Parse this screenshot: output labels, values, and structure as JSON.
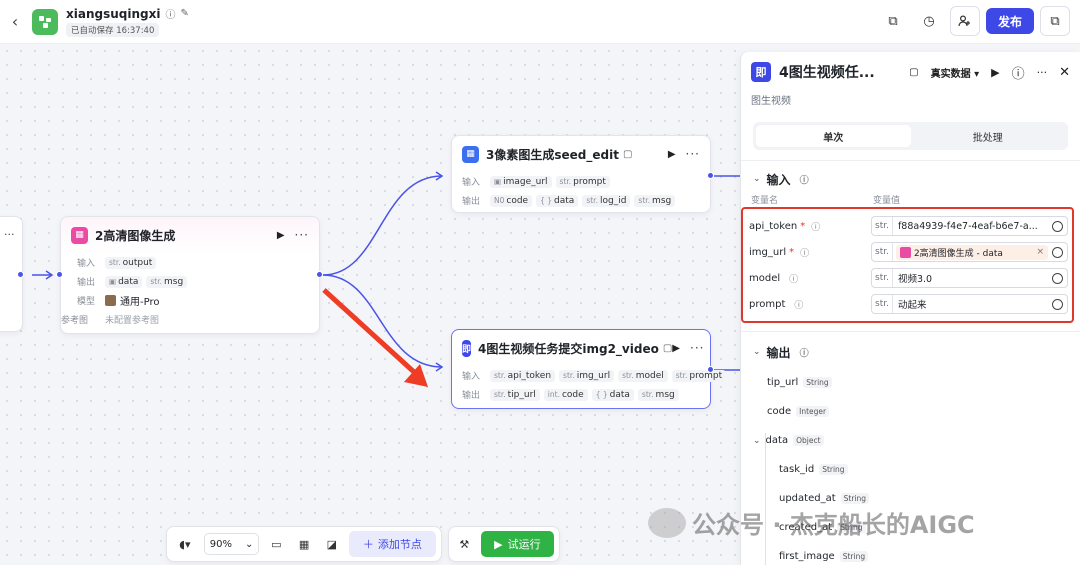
{
  "app": {
    "name": "xiangsuqingxi",
    "saved_status": "已自动保存 16:37:40"
  },
  "toolbar": {
    "publish_label": "发布"
  },
  "nodes": {
    "node2": {
      "title": "2高清图像生成",
      "input_label": "输入",
      "input_params": [
        {
          "type": "str.",
          "name": "output"
        }
      ],
      "output_label": "输出",
      "output_params": [
        {
          "type": "",
          "name": "data"
        },
        {
          "type": "str.",
          "name": "msg"
        }
      ],
      "model_label": "模型",
      "model_value": "通用-Pro",
      "ref_label": "参考图",
      "ref_value": "未配置参考图"
    },
    "node3": {
      "title": "3像素图生成seed_edit",
      "input_label": "输入",
      "input_params": [
        {
          "type": "",
          "name": "image_url"
        },
        {
          "type": "str.",
          "name": "prompt"
        }
      ],
      "output_label": "输出",
      "output_params": [
        {
          "type": "N0",
          "name": "code"
        },
        {
          "type": "{ }",
          "name": "data"
        },
        {
          "type": "str.",
          "name": "log_id"
        },
        {
          "type": "str.",
          "name": "msg"
        }
      ]
    },
    "node4": {
      "title": "4图生视频任务提交img2_video",
      "icon_text": "即",
      "input_label": "输入",
      "input_params": [
        {
          "type": "str.",
          "name": "api_token"
        },
        {
          "type": "str.",
          "name": "img_url"
        },
        {
          "type": "str.",
          "name": "model"
        },
        {
          "type": "str.",
          "name": "prompt"
        }
      ],
      "output_label": "输出",
      "output_params": [
        {
          "type": "str.",
          "name": "tip_url"
        },
        {
          "type": "int.",
          "name": "code"
        },
        {
          "type": "{ }",
          "name": "data"
        },
        {
          "type": "str.",
          "name": "msg"
        }
      ]
    }
  },
  "bottom": {
    "zoom": "90%",
    "add_node": "添加节点",
    "test_run": "试运行"
  },
  "panel": {
    "icon_text": "即",
    "title": "4图生视频任...",
    "data_mode": "真实数据",
    "subtitle": "图生视频",
    "tabs": [
      "单次",
      "批处理"
    ],
    "input_title": "输入",
    "col_name": "变量名",
    "col_value": "变量值",
    "params": [
      {
        "name": "api_token",
        "required": "*",
        "type": "str.",
        "value": "f88a4939-f4e7-4eaf-b6e7-a..."
      },
      {
        "name": "img_url",
        "required": "*",
        "type": "str.",
        "value": "2高清图像生成 - data"
      },
      {
        "name": "model",
        "required": "",
        "type": "str.",
        "value": "视频3.0"
      },
      {
        "name": "prompt",
        "required": "",
        "type": "str.",
        "value": "动起来"
      }
    ],
    "output_title": "输出",
    "outputs": [
      {
        "name": "tip_url",
        "type": "String"
      },
      {
        "name": "code",
        "type": "Integer"
      },
      {
        "name": "data",
        "type": "Object"
      },
      {
        "name": "task_id",
        "type": "String"
      },
      {
        "name": "updated_at",
        "type": "String"
      },
      {
        "name": "created_at",
        "type": "String"
      },
      {
        "name": "first_image",
        "type": "String"
      }
    ]
  },
  "watermark": "公众号 · 杰克船长的AIGC"
}
